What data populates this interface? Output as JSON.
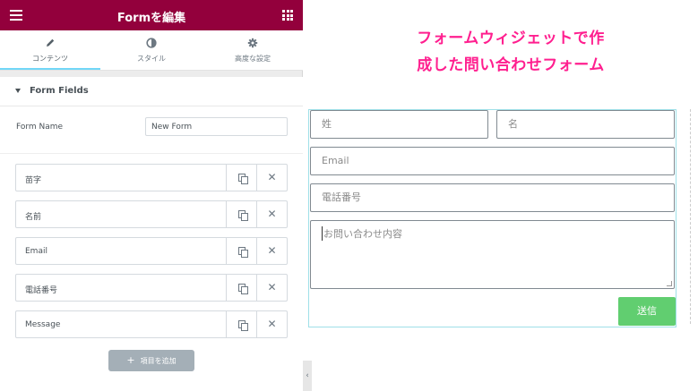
{
  "header": {
    "title": "Formを編集"
  },
  "tabs": [
    {
      "label": "コンテンツ",
      "icon": "pencil-icon",
      "active": true
    },
    {
      "label": "スタイル",
      "icon": "half-circle-icon",
      "active": false
    },
    {
      "label": "高度な設定",
      "icon": "gear-icon",
      "active": false
    }
  ],
  "section": {
    "title": "Form Fields"
  },
  "form_name": {
    "label": "Form Name",
    "value": "New Form"
  },
  "repeater_items": [
    {
      "label": "苗字"
    },
    {
      "label": "名前"
    },
    {
      "label": "Email"
    },
    {
      "label": "電話番号"
    },
    {
      "label": "Message"
    }
  ],
  "add_item": {
    "label": "項目を追加",
    "icon": "plus-icon"
  },
  "caption": {
    "line1": "フォームウィジェットで作",
    "line2": "成した問い合わせフォーム"
  },
  "preview_form": {
    "last_name_placeholder": "姓",
    "first_name_placeholder": "名",
    "email_placeholder": "Email",
    "phone_placeholder": "電話番号",
    "message_placeholder": "お問い合わせ内容",
    "submit_label": "送信"
  },
  "colors": {
    "header": "#93003c",
    "tab_active": "#71d7f7",
    "caption": "#ff1f8f",
    "submit": "#61ce70",
    "add_button": "#a4afb7"
  }
}
